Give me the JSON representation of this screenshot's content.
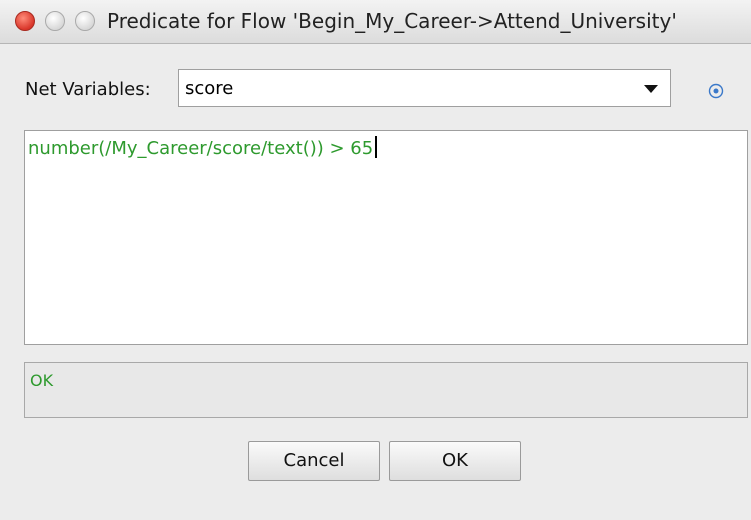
{
  "window": {
    "title": "Predicate for Flow 'Begin_My_Career->Attend_University'"
  },
  "net_variables": {
    "label": "Net Variables:",
    "selected": "score"
  },
  "editor": {
    "expression": "number(/My_Career/score/text()) > 65"
  },
  "status": {
    "message": "OK"
  },
  "buttons": {
    "cancel": "Cancel",
    "ok": "OK"
  },
  "colors": {
    "expression_text": "#2e9a2e",
    "close_button": "#d9362a"
  },
  "icons": {
    "variable_picker": "target-icon"
  }
}
